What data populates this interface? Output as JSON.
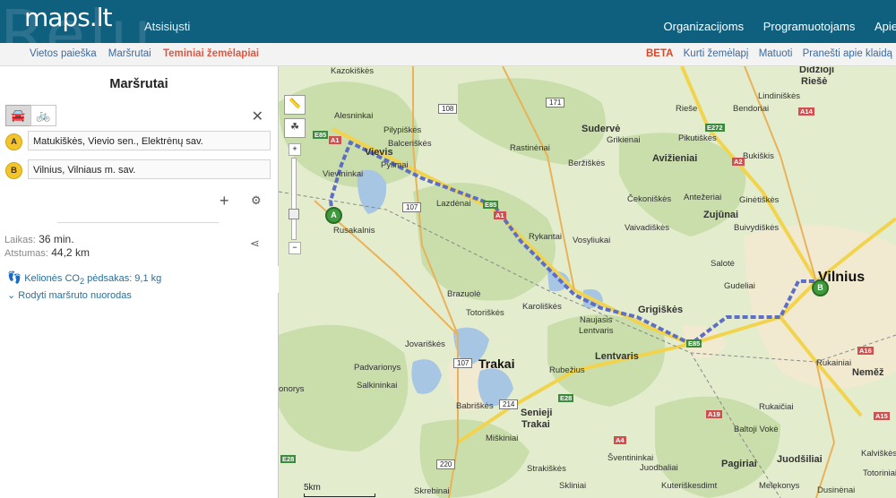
{
  "header": {
    "logo": "maps.lt",
    "ghost_text": "Relu",
    "download": "Atsisiųsti",
    "nav": [
      "Organizacijoms",
      "Programuotojams",
      "Apie"
    ]
  },
  "subnav": {
    "left": [
      "Vietos paieška",
      "Maršrutai",
      "Teminiai žemėlapiai"
    ],
    "active": "Teminiai žemėlapiai",
    "beta": "BETA",
    "right": [
      "Kurti žemėlapį",
      "Matuoti",
      "Pranešti apie klaidą"
    ]
  },
  "panel": {
    "title": "Maršrutai",
    "modes": [
      "car",
      "bicycle"
    ],
    "active_mode": "car",
    "stops": [
      {
        "badge": "A",
        "value": "Matukiškės, Vievio sen., Elektrėnų sav."
      },
      {
        "badge": "B",
        "value": "Vilnius, Vilniaus m. sav."
      }
    ],
    "time_label": "Laikas:",
    "time_value": "36 min.",
    "distance_label": "Atstumas:",
    "distance_value": "44,2 km",
    "co2_label": "Kelionės CO",
    "co2_sub": "2",
    "co2_value": " pėdsakas: 9,1 kg",
    "directions_link": "Rodyti maršruto nuorodas"
  },
  "map": {
    "scale": "5km",
    "pins": {
      "start": "A",
      "end": "B"
    },
    "labels": [
      {
        "t": "Kazokiškės",
        "c": "mlabel"
      },
      {
        "t": "Alesninkai",
        "c": "mlabel"
      },
      {
        "t": "Pilypiškės",
        "c": "mlabel"
      },
      {
        "t": "Balceriškės",
        "c": "mlabel"
      },
      {
        "t": "Pylimai",
        "c": "mlabel"
      },
      {
        "t": "Vievis",
        "c": "mlabel town"
      },
      {
        "t": "Vievininkai",
        "c": "mlabel"
      },
      {
        "t": "Rusakalnis",
        "c": "mlabel"
      },
      {
        "t": "Lazdėnai",
        "c": "mlabel"
      },
      {
        "t": "Rastinėnai",
        "c": "mlabel"
      },
      {
        "t": "Sudervė",
        "c": "mlabel town"
      },
      {
        "t": "Grikienai",
        "c": "mlabel"
      },
      {
        "t": "Beržiškės",
        "c": "mlabel"
      },
      {
        "t": "Rykantai",
        "c": "mlabel"
      },
      {
        "t": "Vosyliukai",
        "c": "mlabel"
      },
      {
        "t": "Brazuolė",
        "c": "mlabel"
      },
      {
        "t": "Totoriškės",
        "c": "mlabel"
      },
      {
        "t": "Karoliškės",
        "c": "mlabel"
      },
      {
        "t": "Naujasis",
        "c": "mlabel"
      },
      {
        "t": "Lentvaris",
        "c": "mlabel"
      },
      {
        "t": "Jovariškės",
        "c": "mlabel"
      },
      {
        "t": "Trakai",
        "c": "mlabel big"
      },
      {
        "t": "Lentvaris",
        "c": "mlabel town"
      },
      {
        "t": "Padvarionys",
        "c": "mlabel"
      },
      {
        "t": "Rubežius",
        "c": "mlabel"
      },
      {
        "t": "Salkininkai",
        "c": "mlabel"
      },
      {
        "t": "onorys",
        "c": "mlabel"
      },
      {
        "t": "Babriškės",
        "c": "mlabel"
      },
      {
        "t": "Senieji",
        "c": "mlabel town"
      },
      {
        "t": "Trakai",
        "c": "mlabel town"
      },
      {
        "t": "Miškiniai",
        "c": "mlabel"
      },
      {
        "t": "Strakiškės",
        "c": "mlabel"
      },
      {
        "t": "Šventininkai",
        "c": "mlabel"
      },
      {
        "t": "Grigiškės",
        "c": "mlabel town"
      },
      {
        "t": "Avižieniai",
        "c": "mlabel town"
      },
      {
        "t": "Rieše",
        "c": "mlabel"
      },
      {
        "t": "Bendoriai",
        "c": "mlabel"
      },
      {
        "t": "Pikutiškės",
        "c": "mlabel"
      },
      {
        "t": "Čekoniškės",
        "c": "mlabel"
      },
      {
        "t": "Antežeriai",
        "c": "mlabel"
      },
      {
        "t": "Zujūnai",
        "c": "mlabel town"
      },
      {
        "t": "Vaivadiškės",
        "c": "mlabel"
      },
      {
        "t": "Salotė",
        "c": "mlabel"
      },
      {
        "t": "Gudeliai",
        "c": "mlabel"
      },
      {
        "t": "Didžioji",
        "c": "mlabel town"
      },
      {
        "t": "Riešė",
        "c": "mlabel town"
      },
      {
        "t": "Lindiniškės",
        "c": "mlabel"
      },
      {
        "t": "Bukiškis",
        "c": "mlabel"
      },
      {
        "t": "Ginėtiškės",
        "c": "mlabel"
      },
      {
        "t": "Buivydiškės",
        "c": "mlabel"
      },
      {
        "t": "Vilnius",
        "c": "mlabel city"
      },
      {
        "t": "Rukainiai",
        "c": "mlabel"
      },
      {
        "t": "Baltoji Vokė",
        "c": "mlabel"
      },
      {
        "t": "Pagiriai",
        "c": "mlabel town"
      },
      {
        "t": "Juodšiliai",
        "c": "mlabel town"
      },
      {
        "t": "Neměž",
        "c": "mlabel town"
      },
      {
        "t": "Juodbaliai",
        "c": "mlabel"
      },
      {
        "t": "Dusinėnai",
        "c": "mlabel"
      },
      {
        "t": "Skrebinai",
        "c": "mlabel"
      },
      {
        "t": "Kalviškės",
        "c": "mlabel"
      },
      {
        "t": "Totoriniai",
        "c": "mlabel"
      },
      {
        "t": "Melekonys",
        "c": "mlabel"
      },
      {
        "t": "Skliniai",
        "c": "mlabel"
      },
      {
        "t": "Kuteriškesdimt",
        "c": "mlabel"
      },
      {
        "t": "Rukaičiai",
        "c": "mlabel"
      }
    ],
    "road_numbers": [
      "108",
      "171",
      "107",
      "107",
      "214",
      "220",
      "E85",
      "E85",
      "E85",
      "E28",
      "E28",
      "E272",
      "A1",
      "A1",
      "A2",
      "A14",
      "A19",
      "A4",
      "A16",
      "A15"
    ]
  }
}
